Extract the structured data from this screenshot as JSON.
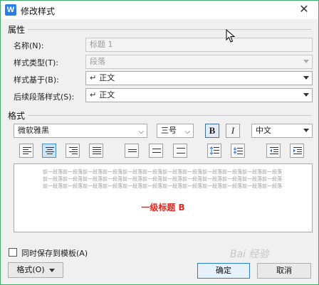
{
  "window": {
    "title": "修改样式",
    "app_icon_letter": "W",
    "close_glyph": "✕"
  },
  "properties": {
    "section_title": "属性",
    "name_label": "名称(N):",
    "name_value": "标题 1",
    "style_type_label": "样式类型(T):",
    "style_type_value": "段落",
    "based_on_label": "样式基于(B):",
    "based_on_value": "正文",
    "next_style_label": "后续段落样式(S):",
    "next_style_value": "正文",
    "para_mark": "↵"
  },
  "format": {
    "section_title": "格式",
    "font_value": "微软雅黑",
    "size_value": "三号",
    "bold_label": "B",
    "italic_label": "I",
    "lang_value": "中文"
  },
  "preview": {
    "sample_text": "前一段落前一段落前一段落前一段落前一段落前一段落前一段落前一段落前一段落前一段落前一段落前一段落",
    "heading_text": "一级标题 B"
  },
  "footer": {
    "save_to_template_label": "同时保存到模板(A)",
    "format_button_label": "格式(O)",
    "ok_label": "确定",
    "cancel_label": "取消",
    "watermark": "Bai 经验"
  },
  "colors": {
    "accent": "#2f7bd9",
    "heading_red": "#e1261c",
    "border_green": "#3fae6a"
  }
}
